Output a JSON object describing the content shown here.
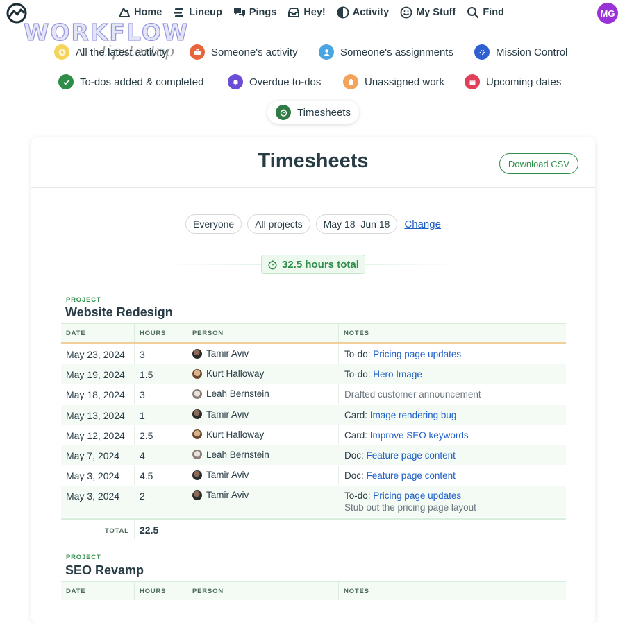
{
  "nav": {
    "items": [
      {
        "label": "Home",
        "icon": "home-icon"
      },
      {
        "label": "Lineup",
        "icon": "lineup-icon"
      },
      {
        "label": "Pings",
        "icon": "pings-icon"
      },
      {
        "label": "Hey!",
        "icon": "hey-inbox-icon"
      },
      {
        "label": "Activity",
        "icon": "activity-icon"
      },
      {
        "label": "My Stuff",
        "icon": "smiley-icon"
      },
      {
        "label": "Find",
        "icon": "search-icon"
      }
    ],
    "avatar_initials": "MG"
  },
  "watermark": {
    "title": "WORKFLOW",
    "subtitle": "tipstertop"
  },
  "reports": {
    "latest": "All the latest activity",
    "someone_activity": "Someone's activity",
    "someone_assignments": "Someone's assignments",
    "mission_control": "Mission Control",
    "todos": "To-dos added & completed",
    "overdue": "Overdue to-dos",
    "unassigned": "Unassigned work",
    "upcoming": "Upcoming dates",
    "timesheets": "Timesheets"
  },
  "colors": {
    "accent_green": "#2f8d4a",
    "link_blue": "#1e5fc8",
    "avatar_purple": "#9a32d8"
  },
  "page": {
    "title": "Timesheets",
    "download_label": "Download CSV",
    "filters": {
      "people": "Everyone",
      "projects": "All projects",
      "range": "May 18–Jun 18",
      "change": "Change"
    },
    "total": "32.5 hours total"
  },
  "table_headers": {
    "date": "DATE",
    "hours": "HOURS",
    "person": "PERSON",
    "notes": "NOTES"
  },
  "projects": [
    {
      "label": "PROJECT",
      "name": "Website Redesign",
      "rows": [
        {
          "date": "May 23, 2024",
          "hours": "3",
          "person": "Tamir Aviv",
          "prefix": "To-do:",
          "link": "Pricing page updates"
        },
        {
          "date": "May 19, 2024",
          "hours": "1.5",
          "person": "Kurt Halloway",
          "prefix": "To-do:",
          "link": "Hero Image"
        },
        {
          "date": "May 18, 2024",
          "hours": "3",
          "person": "Leah Bernstein",
          "note": "Drafted customer announcement"
        },
        {
          "date": "May 13, 2024",
          "hours": "1",
          "person": "Tamir Aviv",
          "prefix": "Card:",
          "link": "Image rendering bug"
        },
        {
          "date": "May 12, 2024",
          "hours": "2.5",
          "person": "Kurt Halloway",
          "prefix": "Card:",
          "link": "Improve SEO keywords"
        },
        {
          "date": "May 7, 2024",
          "hours": "4",
          "person": "Leah Bernstein",
          "prefix": "Doc:",
          "link": "Feature page content"
        },
        {
          "date": "May 3, 2024",
          "hours": "4.5",
          "person": "Tamir Aviv",
          "prefix": "Doc:",
          "link": "Feature page content"
        },
        {
          "date": "May 3, 2024",
          "hours": "2",
          "person": "Tamir Aviv",
          "prefix": "To-do:",
          "link": "Pricing page updates",
          "note": "Stub out the pricing page layout"
        }
      ],
      "total_label": "TOTAL",
      "total": "22.5"
    },
    {
      "label": "PROJECT",
      "name": "SEO Revamp"
    }
  ]
}
